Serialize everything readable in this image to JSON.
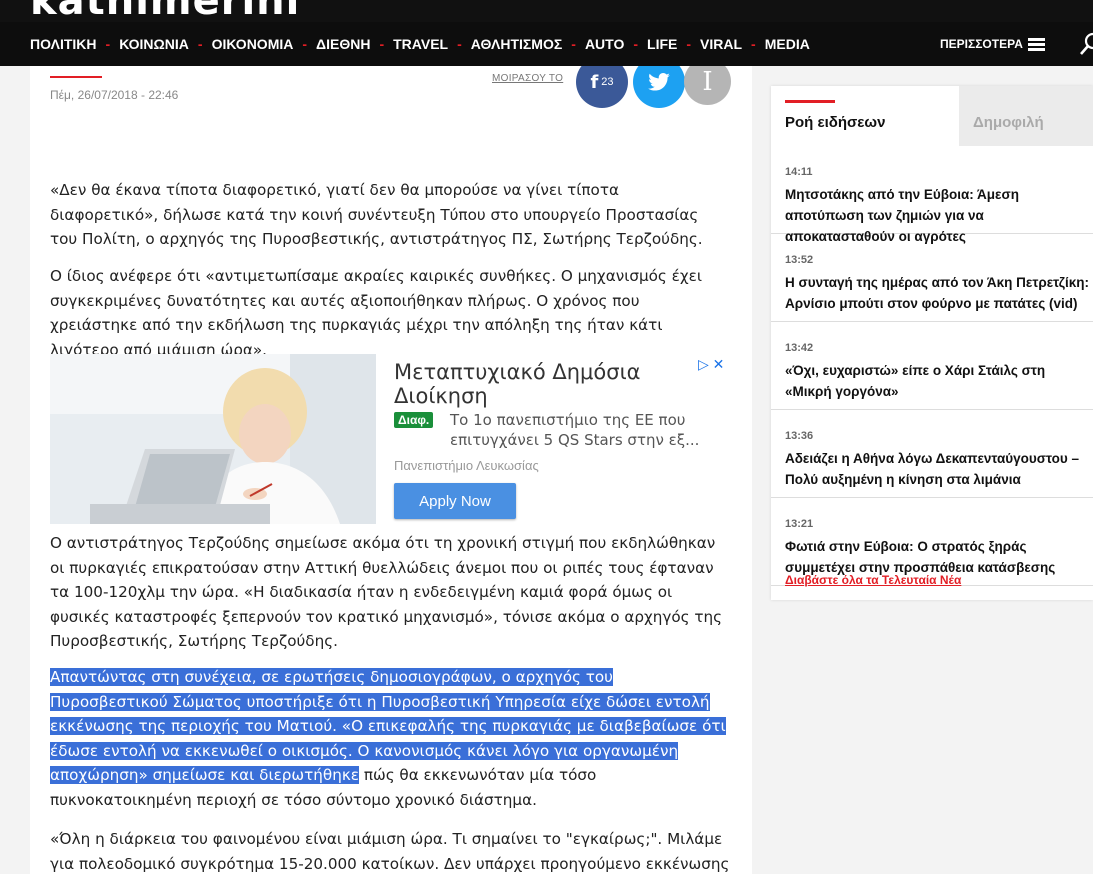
{
  "header": {
    "logo": "kathimerini",
    "nav": [
      "ΠΟΛΙΤΙΚΗ",
      "ΚΟΙΝΩΝΙΑ",
      "ΟΙΚΟΝΟΜΙΑ",
      "ΔΙΕΘΝΗ",
      "TRAVEL",
      "ΑΘΛΗΤΙΣΜΟΣ",
      "AUTO",
      "LIFE",
      "VIRAL",
      "MEDIA"
    ],
    "separator": "-",
    "more_label": "ΠΕΡΙΣΣΟΤΕΡΑ"
  },
  "article": {
    "date": "Πέμ, 26/07/2018 - 22:46",
    "share_label": "ΜΟΙΡΑΣΟΥ ΤΟ",
    "facebook_count": "23",
    "facebook_glyph": "f",
    "instagram_glyph": "I",
    "paragraphs": [
      "«Δεν θα έκανα τίποτα διαφορετικό, γιατί δεν θα μπορούσε να γίνει τίποτα διαφορετικό», δήλωσε κατά την κοινή συνέντευξη Τύπου στο υπουργείο Προστασίας του Πολίτη, ο αρχηγός της Πυροσβεστικής, αντιστράτηγος ΠΣ, Σωτήρης Τερζούδης.",
      "Ο ίδιος ανέφερε ότι «αντιμετωπίσαμε ακραίες καιρικές συνθήκες. Ο μηχανισμός έχει συγκεκριμένες δυνατότητες και αυτές αξιοποιήθηκαν πλήρως. Ο χρόνος που χρειάστηκε από την εκδήλωση της πυρκαγιάς μέχρι την απόληξη της ήταν κάτι λιγότερο από μιάμιση ώρα».",
      "Ο αντιστράτηγος Τερζούδης σημείωσε ακόμα ότι τη χρονική στιγμή που εκδηλώθηκαν οι πυρκαγιές επικρατούσαν στην Αττική θυελλώδεις άνεμοι που οι ριπές τους έφταναν  τα 100-120χλμ την ώρα. «Η διαδικασία ήταν η ενδεδειγμένη καμιά φορά όμως οι φυσικές καταστροφές ξεπερνούν τον κρατικό μηχανισμό», τόνισε ακόμα ο αρχηγός της Πυροσβεστικής, Σωτήρης Τερζούδης.",
      "«Όλη η διάρκεια του φαινομένου είναι μιάμιση ώρα. Τι σημαίνει το \"εγκαίρως;\". Μιλάμε για πολεοδομικό συγκρότημα 15-20.000 κατοίκων. Δεν υπάρχει προηγούμενο εκκένωσης σε"
    ],
    "highlighted_paragraph": "Απαντώντας στη συνέχεια, σε ερωτήσεις δημοσιογράφων, ο αρχηγός του Πυροσβεστικού Σώματος υποστήριξε ότι η Πυροσβεστική Υπηρεσία είχε δώσει εντολή εκκένωσης της περιοχής του Ματιού. «Ο επικεφαλής της πυρκαγιάς με διαβεβαίωσε ότι έδωσε εντολή να εκκενωθεί ο οικισμός. Ο κανονισμός κάνει λόγο για οργανωμένη αποχώρηση» σημείωσε και διερωτήθηκε",
    "highlighted_tail": " πώς θα εκκενωνόταν μία τόσο πυκνοκατοικημένη περιοχή σε τόσο σύντομο χρονικό διάστημα."
  },
  "ad": {
    "title": "Μεταπτυχιακό Δημόσια Διοίκηση",
    "badge": "Διαφ.",
    "description": "Το 1ο πανεπιστήμιο της ΕΕ που επιτυγχάνει 5 QS Stars στην εξ...",
    "source": "Πανεπιστήμιο Λευκωσίας",
    "cta": "Apply Now",
    "icons": "▷ ✕"
  },
  "sidebar": {
    "tab_active": "Ροή ειδήσεων",
    "tab_inactive": "Δημοφιλή",
    "items": [
      {
        "time": "14:11",
        "title": "Μητσοτάκης από την Εύβοια: Άμεση αποτύπωση των ζημιών για να αποκατασταθούν οι αγρότες"
      },
      {
        "time": "13:52",
        "title": "Η συνταγή της ημέρας από τον Άκη Πετρετζίκη: Αρνίσιο μπούτι στον φούρνο με πατάτες (vid)"
      },
      {
        "time": "13:42",
        "title": "«Όχι, ευχαριστώ» είπε ο Χάρι Στάιλς στη «Μικρή γοργόνα»"
      },
      {
        "time": "13:36",
        "title": "Αδειάζει η Αθήνα λόγω Δεκαπενταύγουστου – Πολύ αυξημένη η κίνηση στα λιμάνια"
      },
      {
        "time": "13:21",
        "title": "Φωτιά στην Εύβοια: Ο στρατός ξηράς συμμετέχει στην προσπάθεια κατάσβεσης"
      }
    ],
    "read_all": "Διαβάστε όλα τα Τελευταία Νέα"
  }
}
